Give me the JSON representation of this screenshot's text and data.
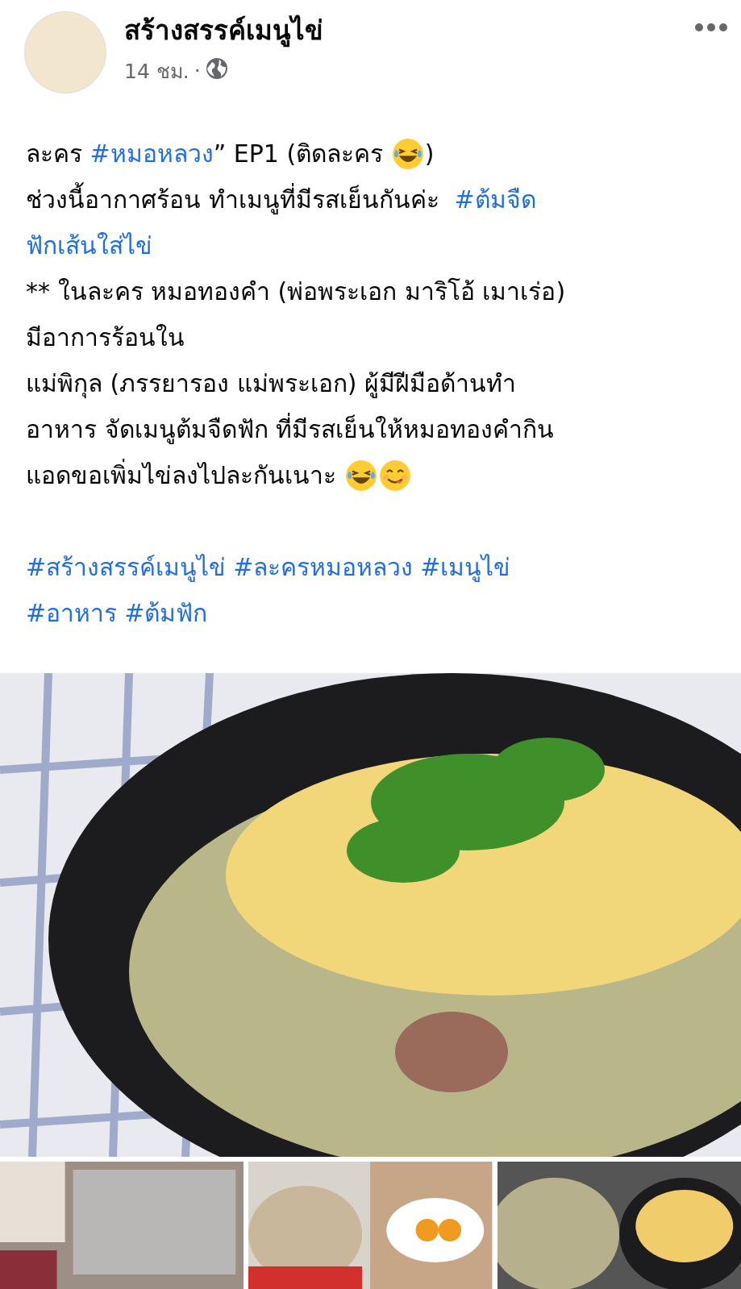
{
  "page": {
    "name": "สร้างสรรค์เมนูไข่",
    "time": "14 ชม.",
    "separator": "·"
  },
  "paragraphs": [
    [
      [
        {
          "kind": "text",
          "text": "ละคร "
        },
        {
          "kind": "hashtag",
          "text": "#หมอหลวง"
        },
        {
          "kind": "text",
          "text": "” EP1 (ติดละคร "
        },
        {
          "kind": "laughing-emoji"
        },
        {
          "kind": "text",
          "text": ")"
        }
      ],
      [
        {
          "kind": "text",
          "text": "ช่วงนี้อากาศร้อน ทำเมนูที่มีรสเย็นกันค่ะ  "
        },
        {
          "kind": "hashtag",
          "text": "#ต้มจืด"
        }
      ],
      [
        {
          "kind": "hashtag",
          "text": "ฟักเส้นใส่ไข่"
        }
      ],
      [
        {
          "kind": "text",
          "text": "** ในละคร หมอทองคำ (พ่อพระเอก มาริโอ้ เมาเร่อ)"
        }
      ],
      [
        {
          "kind": "text",
          "text": "มีอาการร้อนใน"
        }
      ],
      [
        {
          "kind": "text",
          "text": "แม่พิกุล (ภรรยารอง แม่พระเอก) ผู้มีฝีมือด้านทำ"
        }
      ],
      [
        {
          "kind": "text",
          "text": "อาหาร จัดเมนูต้มจืดฟัก ที่มีรสเย็นให้หมอทองคำกิน"
        }
      ],
      [
        {
          "kind": "text",
          "text": "แอดขอเพิ่มไข่ลงไปละกันเนาะ "
        },
        {
          "kind": "laughing-emoji"
        },
        {
          "kind": "yum-emoji"
        }
      ]
    ],
    [
      [
        {
          "kind": "hashtag",
          "text": "#สร้างสรรค์เมนูไข่"
        },
        {
          "kind": "hashtag",
          "text": "#ละครหมอหลวง"
        },
        {
          "kind": "hashtag",
          "text": "#เมนูไข่"
        }
      ],
      [
        {
          "kind": "hashtag",
          "text": "#อาหาร"
        },
        {
          "kind": "hashtag",
          "text": "#ต้มฟัก"
        }
      ]
    ]
  ]
}
